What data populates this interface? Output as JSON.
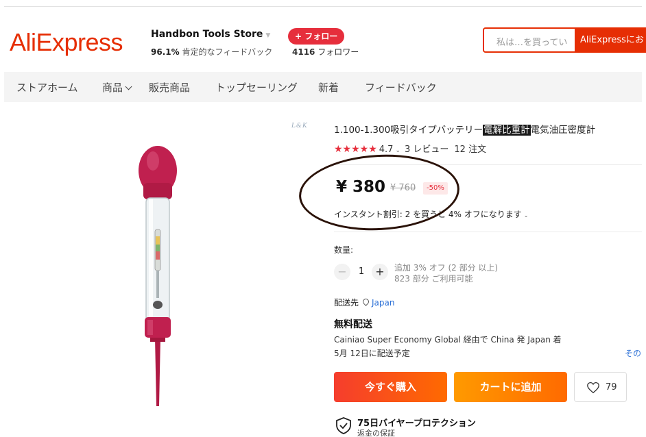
{
  "header": {
    "logo": "AliExpress",
    "store_name": "Handbon Tools Store",
    "feedback_percent": "96.1%",
    "feedback_label": "肯定的なフィードバック",
    "follow_label": "+ フォロー",
    "followers_count": "4116",
    "followers_label": "フォロワー",
    "search_placeholder": "私は…を買ってい",
    "search_button": "AliExpressにお"
  },
  "nav": {
    "items": [
      "ストアホーム",
      "商品",
      "販売商品",
      "トップセーリング",
      "新着",
      "フィードバック"
    ]
  },
  "product": {
    "watermark": "L&K",
    "title_before": "1.100-1.300吸引タイプバッテリー",
    "title_highlight": "電解比重計",
    "title_after": "電気油圧密度計",
    "stars": "★★★★★",
    "rating": "4.7",
    "reviews": "3 レビュー",
    "orders": "12 注文",
    "price": "¥ 380",
    "original_price": "¥ 760",
    "discount": "-50%",
    "instant_discount": "インスタント割引: 2 を買うと 4% オフになります",
    "quantity_label": "数量:",
    "quantity_value": "1",
    "qty_note1": "追加 3% オフ (2 部分 以上)",
    "qty_note2": "823 部分 ご利用可能",
    "ship_to_label": "配送先",
    "ship_to_country": "Japan",
    "free_shipping": "無料配送",
    "shipping_via": "Cainiao Super Economy Global 経由で China 発 Japan 着",
    "delivery_date": "5月 12日に配送予定",
    "other_link": "その",
    "buy_now": "今すぐ購入",
    "add_to_cart": "カートに追加",
    "wishlist_count": "79",
    "protection_title": "75日バイヤープロテクション",
    "protection_sub": "返金の保証"
  },
  "colors": {
    "brand": "#e62e04",
    "accent": "#e62e3c",
    "link": "#2a6fd6"
  }
}
